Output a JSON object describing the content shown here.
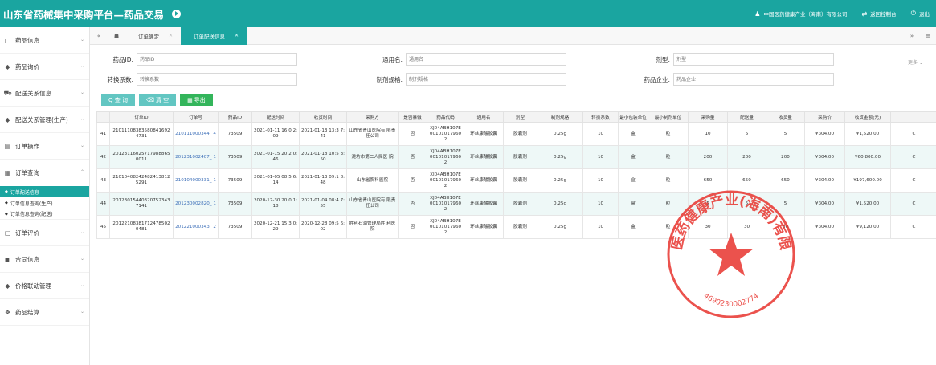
{
  "header": {
    "title": "山东省药械集中采购平台—药品交易",
    "company": "中国医药健康产业（海南）有限公司",
    "back_label": "返回控制台",
    "logout_label": "退出"
  },
  "sidebar": {
    "items": [
      {
        "label": "药品信息",
        "icon": "pill-icon"
      },
      {
        "label": "药品询价",
        "icon": "diamond-icon"
      },
      {
        "label": "配送关系信息",
        "icon": "truck-icon"
      },
      {
        "label": "配送关系管理(生产)",
        "icon": "diamond-icon"
      },
      {
        "label": "订单操作",
        "icon": "list-icon"
      },
      {
        "label": "订单查询",
        "icon": "search-list-icon"
      }
    ],
    "subitems": [
      {
        "label": "订单配送信息"
      },
      {
        "label": "订单信息查询(生产)"
      },
      {
        "label": "订单信息查询(配送)"
      }
    ],
    "items_after": [
      {
        "label": "订单评价",
        "icon": "comment-icon"
      },
      {
        "label": "合同信息",
        "icon": "book-icon"
      },
      {
        "label": "价格联动管理",
        "icon": "diamond-icon"
      },
      {
        "label": "药品结算",
        "icon": "handshake-icon"
      }
    ]
  },
  "tabs": [
    {
      "label": "订单确定"
    },
    {
      "label": "订单配送信息"
    }
  ],
  "filters": {
    "drug_id_label": "药品ID:",
    "drug_id_placeholder": "药品ID",
    "generic_name_label": "通用名:",
    "generic_name_placeholder": "通用名",
    "dosage_form_label": "剂型:",
    "dosage_form_placeholder": "剂型",
    "conversion_label": "转换系数:",
    "conversion_placeholder": "转换系数",
    "spec_label": "制剂规格:",
    "spec_placeholder": "制剂规格",
    "company_label": "药品企业:",
    "company_placeholder": "药品企业",
    "more_label": "更多 ⌄"
  },
  "buttons": {
    "query": "Q 查 询",
    "clear": "清 空",
    "export": "导出"
  },
  "table": {
    "columns": [
      "",
      "订单ID",
      "订单号",
      "药品ID",
      "配送时间",
      "收货时间",
      "采购方",
      "是否暴徽",
      "药品代码",
      "通用名",
      "剂型",
      "制剂规格",
      "转换系数",
      "最小包装单位",
      "最小制剂单位",
      "采购量",
      "配送量",
      "收货量",
      "采购价",
      "收货金额(元)",
      ""
    ],
    "rows": [
      [
        "41",
        "21011108383580841692 4731",
        "210111000344_ 4",
        "73509",
        "2021-01-11 16:0 2:09",
        "2021-01-13 13:3 7:41",
        "山东省青山医院有 限责任公司",
        "否",
        "XJ04ABH107E 00101017960 2",
        "环丝康酸胶囊",
        "胶囊剂",
        "0.25g",
        "10",
        "盒",
        "粒",
        "10",
        "5",
        "5",
        "¥304.00",
        "¥1,520.00",
        "C"
      ],
      [
        "42",
        "20123116025717988865 0011",
        "201231002407_ 1",
        "73509",
        "2021-01-15 20:2 0:46",
        "2021-01-18 10:5 3:50",
        "潍坊市第二人民医 院",
        "否",
        "XJ04ABH107E 00101017960 2",
        "环丝康酸胶囊",
        "胶囊剂",
        "0.25g",
        "10",
        "盒",
        "粒",
        "200",
        "200",
        "200",
        "¥304.00",
        "¥60,800.00",
        "C"
      ],
      [
        "43",
        "21010408242482413812 5291",
        "210104000331_ 1",
        "73509",
        "2021-01-05 08:5 6:14",
        "2021-01-13 09:1 8:48",
        "山东省胸科医院",
        "否",
        "XJ04ABH107E 00101017960 2",
        "环丝康酸胶囊",
        "胶囊剂",
        "0.25g",
        "10",
        "盒",
        "粒",
        "650",
        "650",
        "650",
        "¥304.00",
        "¥197,600.00",
        "C"
      ],
      [
        "44",
        "20123015440320752343 7141",
        "201230002820_ 1",
        "73509",
        "2020-12-30 20:0 1:18",
        "2021-01-04 08:4 7:55",
        "山东省青山医院有 限责任公司",
        "否",
        "XJ04ABH107E 00101017960 2",
        "环丝康酸胶囊",
        "胶囊剂",
        "0.25g",
        "10",
        "盒",
        "粒",
        "5",
        "5",
        "5",
        "¥304.00",
        "¥1,520.00",
        "C"
      ],
      [
        "45",
        "20122108381712478502 0481",
        "201221000343_ 2",
        "73509",
        "2020-12-21 15:3 0:29",
        "2020-12-28 09:5 6:02",
        "胜利石油管理局胜 利医院",
        "否",
        "XJ04ABH107E 00101017960 2",
        "环丝康酸胶囊",
        "胶囊剂",
        "0.25g",
        "10",
        "盒",
        "粒",
        "30",
        "30",
        "30",
        "¥304.00",
        "¥9,120.00",
        "C"
      ]
    ]
  },
  "stamp": {
    "text": "中国医药健康产业(海南)有限公司",
    "number": "4690230002774",
    "color": "#e8342e"
  }
}
